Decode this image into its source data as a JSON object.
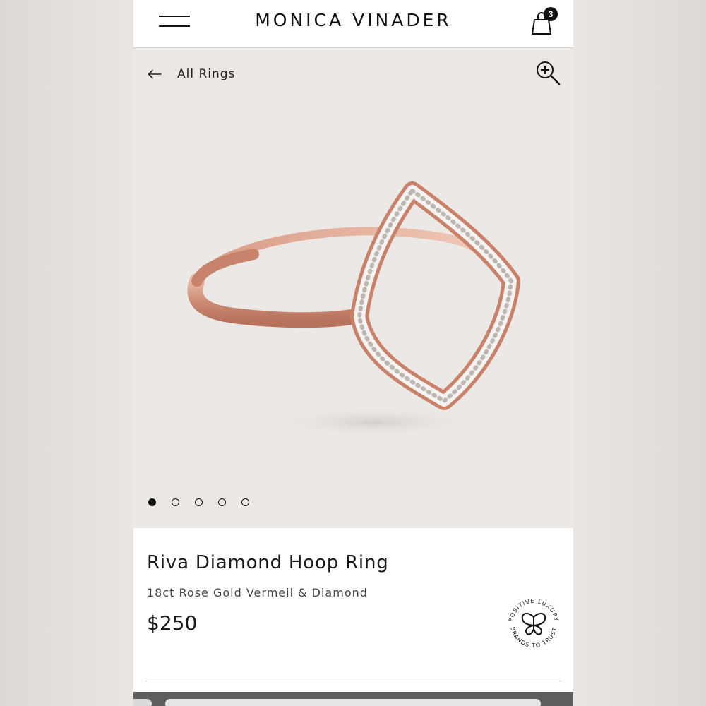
{
  "header": {
    "brand": "MONICA VINADER",
    "cart_count": "3"
  },
  "icons": {
    "menu": "hamburger-menu-icon",
    "cart": "shopping-bag-icon",
    "back": "arrow-left-icon",
    "zoom": "zoom-in-icon"
  },
  "gallery": {
    "back_label": "All Rings",
    "image_description": "rose gold open diamond hoop ring",
    "slide_count": 5,
    "active_slide": 1
  },
  "product": {
    "name": "Riva Diamond Hoop Ring",
    "material": "18ct Rose Gold Vermeil & Diamond",
    "price": "$250"
  },
  "badge": {
    "text_top": "POSITIVE LUXURY",
    "text_bottom": "BRANDS TO TRUST",
    "icon": "butterfly-icon"
  },
  "colors": {
    "gallery_bg": "#ebe8e5",
    "rose_gold": "#d69a86",
    "text": "#1a1a1a"
  }
}
